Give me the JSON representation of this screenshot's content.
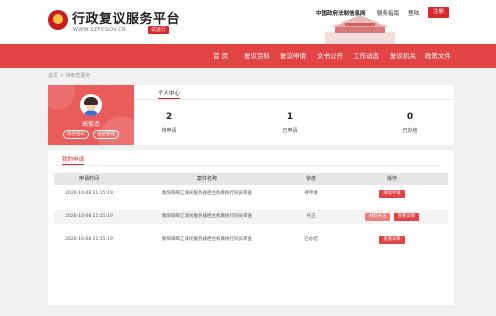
{
  "header": {
    "title": "行政复议服务平台",
    "url_text": "WWW.XZFY.GOV.CN",
    "badge": "试运行",
    "gov_link": "中国政府法制信息网",
    "service_link": "服务指南",
    "login": "登陆",
    "register": "注册"
  },
  "nav": {
    "items": [
      "首 页",
      "复议百科",
      "复议申请",
      "文书公开",
      "工作动态",
      "复议机关",
      "政策文件"
    ]
  },
  "breadcrumb": "首页 > 待审查服务",
  "profile": {
    "name": "高俊杰",
    "edit_label": "修改密码",
    "address_label": "送达管理"
  },
  "stats": {
    "tab": "个人中心",
    "items": [
      {
        "value": "2",
        "label": "待申请"
      },
      {
        "value": "1",
        "label": "已申请"
      },
      {
        "value": "0",
        "label": "已办结"
      }
    ]
  },
  "applications": {
    "title": "我的申请",
    "columns": [
      "申请时间",
      "案件名称",
      "状态",
      "操作"
    ],
    "rows": [
      {
        "time": "2020-10-08  21:15:19",
        "name": "衡阳珠晖江泽民服务器柜台机库执行同员审查",
        "status": "待申请",
        "actions": [
          "继续申请"
        ]
      },
      {
        "time": "2020-10-08  21:15:19",
        "name": "衡阳珠晖江泽民服务器柜台机库执行同员审查",
        "status": "补正",
        "actions": [
          "材料补正",
          "查看详情"
        ]
      },
      {
        "time": "2020-10-08  21:15:19",
        "name": "衡阳珠晖江泽民服务器柜台机库执行同员审查",
        "status": "已办结",
        "actions": [
          "查看详情"
        ]
      }
    ]
  },
  "colors": {
    "brand_red": "#d9282a",
    "nav_red": "#e24445",
    "profile_red": "#ea5b5b"
  }
}
